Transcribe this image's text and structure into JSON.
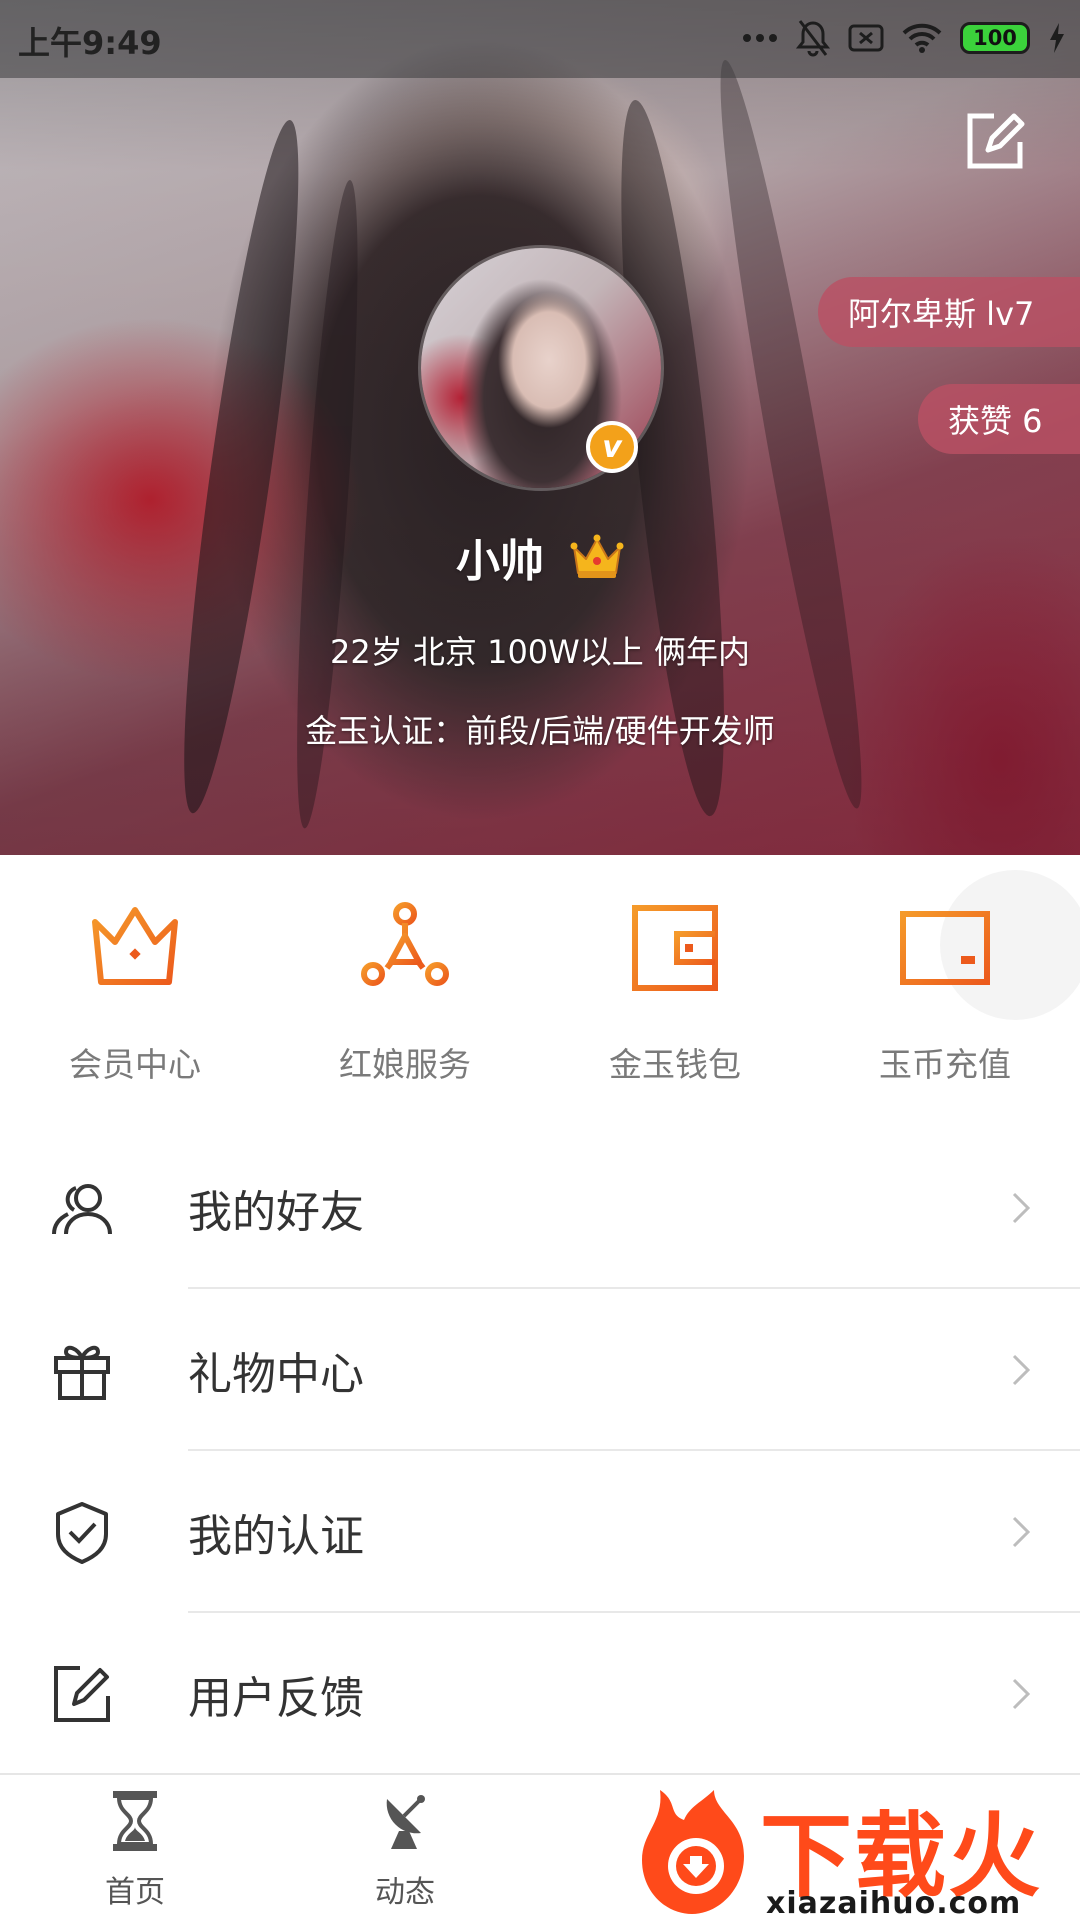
{
  "status_bar": {
    "time": "上午9:49",
    "battery": "100"
  },
  "header": {
    "level_badge": "阿尔卑斯 lv7",
    "likes_badge": "获赞 6",
    "name": "小帅",
    "verified_badge": "v",
    "basic_info": "22岁 北京 100W以上 俩年内",
    "certification": "金玉认证：前段/后端/硬件开发师"
  },
  "quick_actions": [
    {
      "label": "会员中心",
      "icon": "crown-icon"
    },
    {
      "label": "红娘服务",
      "icon": "network-icon"
    },
    {
      "label": "金玉钱包",
      "icon": "wallet-icon"
    },
    {
      "label": "玉币充值",
      "icon": "card-icon"
    }
  ],
  "menu": [
    {
      "label": "我的好友",
      "icon": "friends-icon"
    },
    {
      "label": "礼物中心",
      "icon": "gift-icon"
    },
    {
      "label": "我的认证",
      "icon": "shield-check-icon"
    },
    {
      "label": "用户反馈",
      "icon": "feedback-icon"
    }
  ],
  "bottom_nav": [
    {
      "label": "首页",
      "icon": "hourglass-icon"
    },
    {
      "label": "动态",
      "icon": "satellite-dish-icon"
    }
  ],
  "watermark": {
    "brand": "下载火",
    "url": "xiazaihuo.com"
  },
  "colors": {
    "accent": "#f06e1e",
    "pill": "#b95064",
    "badge": "#f3a11a",
    "watermark": "#ff4a1a"
  }
}
